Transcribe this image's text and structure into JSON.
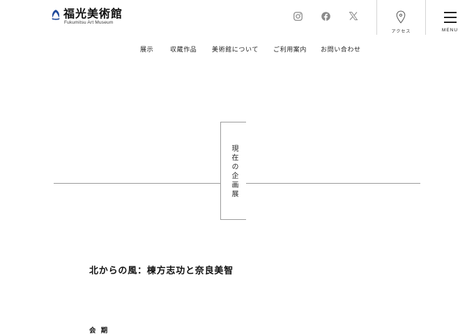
{
  "brand": {
    "name_jp": "福光美術館",
    "name_en": "Fukumitsu Art Museum",
    "color": "#1f4a9b"
  },
  "header": {
    "sns": [
      {
        "icon": "instagram-icon"
      },
      {
        "icon": "facebook-icon"
      },
      {
        "icon": "x-icon"
      }
    ],
    "access_label": "アクセス",
    "menu_label": "MENU"
  },
  "nav": {
    "items": [
      "展示",
      "収蔵作品",
      "美術館について",
      "ご利用案内",
      "お問い合わせ"
    ]
  },
  "section": {
    "heading": "現在の企画展"
  },
  "exhibition": {
    "title": "北からの風：棟方志功と奈良美智",
    "period_label": "会 期"
  },
  "colors": {
    "icon_gray": "#8a8a8a",
    "line_gray": "#9a9a9a",
    "text": "#1a1a1a"
  }
}
